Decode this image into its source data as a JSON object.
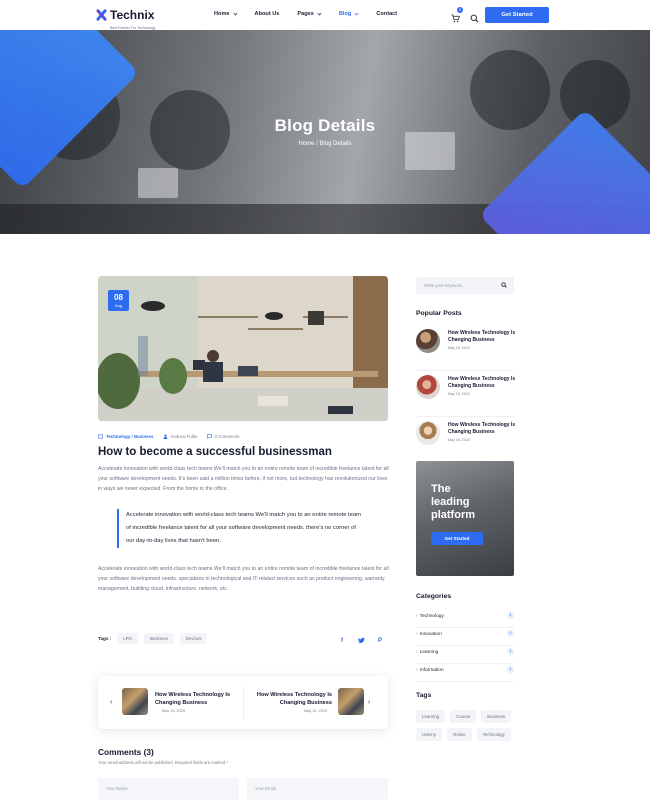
{
  "brand": {
    "name": "Technix",
    "tagline": "Best Partner For Technology"
  },
  "nav": [
    {
      "label": "Home",
      "has_menu": true,
      "active": false
    },
    {
      "label": "About Us",
      "has_menu": false,
      "active": false
    },
    {
      "label": "Pages",
      "has_menu": true,
      "active": false
    },
    {
      "label": "Blog",
      "has_menu": true,
      "active": true
    },
    {
      "label": "Contact",
      "has_menu": false,
      "active": false
    }
  ],
  "header": {
    "cart_count": "0",
    "cta_label": "Get Started",
    "cart_icon": "cart-icon",
    "search_icon": "search-icon"
  },
  "hero": {
    "title": "Blog Details",
    "breadcrumb": "Home / Blog Details"
  },
  "post": {
    "date_day": "08",
    "date_month": "Aug",
    "categories": "Technology / Business",
    "author": "Andrew Fuller",
    "comments": "0 Comments",
    "title": "How to become a successful businessman",
    "para1": "Accelerate innovation with world-class tech teams We'll match you to an entire remote team of incredible freelance talent for all your software development needs. It's been said a million times before, if not more, but technology has revolutionized our lives in ways we never expected. From the home to the office.",
    "quote": "Accelerate innovation with world-class tech teams We'll match you to an entire remote team of incredible freelance talent for all your software development needs. there's no corner of our day-to-day lives that hasn't been.",
    "para2": "Accelerate innovation with world-class tech teams We'll match you to an entire remote team of incredible freelance talent for all your software development needs. specializes in technological and IT-related services such as product engineering, warranty management, building cloud, infrastructure, network, etc.",
    "tags_label": "Tags :",
    "tags": [
      "LPG",
      "Business",
      "Devices"
    ],
    "share_icons": [
      "facebook-icon",
      "twitter-icon",
      "pinterest-icon"
    ]
  },
  "post_nav": {
    "prev": {
      "title": "How Wireless Technology Is Changing Business",
      "date": "May 15, 2024"
    },
    "next": {
      "title": "How Wireless Technology Is Changing Business",
      "date": "May 15, 2024"
    }
  },
  "comments": {
    "title": "Comments (3)",
    "note": "Your email address will not be published. Required fields are marked *",
    "name_placeholder": "Your Name",
    "email_placeholder": "Your Email"
  },
  "sidebar": {
    "search_placeholder": "Write your keyword...",
    "popular_title": "Popular Posts",
    "popular": [
      {
        "title": "How Wireless Technology Is Changing Business",
        "date": "May 15, 2024"
      },
      {
        "title": "How Wireless Technology Is Changing Business",
        "date": "May 15, 2024"
      },
      {
        "title": "How Wireless Technology Is Changing Business",
        "date": "May 15, 2024"
      }
    ],
    "promo": {
      "line1": "The",
      "line2": "leading",
      "line3": "platform",
      "button": "Get Started"
    },
    "categories_title": "Categories",
    "categories": [
      {
        "label": "Technology",
        "count": "1"
      },
      {
        "label": "Innovation",
        "count": "1"
      },
      {
        "label": "Learning",
        "count": "1"
      },
      {
        "label": "Information",
        "count": "1"
      }
    ],
    "tags_title": "Tags",
    "tags": [
      "Learning",
      "Course",
      "Business",
      "Udemy",
      "Online",
      "Technology"
    ]
  },
  "colors": {
    "accent": "#2e6bf0",
    "accent2": "#6a4fd8",
    "text": "#171b2e",
    "muted": "#6d7185"
  }
}
